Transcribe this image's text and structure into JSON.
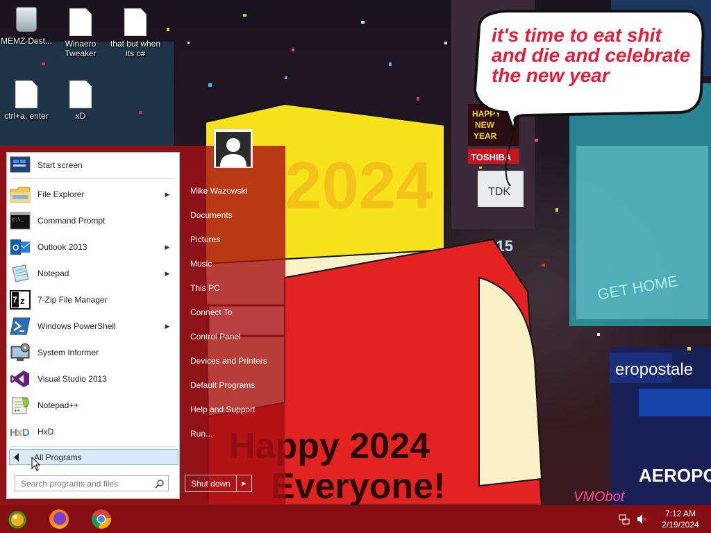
{
  "desktop": {
    "icons": [
      {
        "label": "MEMZ-Dest...",
        "icon": "recycle-bin-icon"
      },
      {
        "label": "Winaero Tweaker",
        "icon": "document-icon"
      },
      {
        "label": "that but when its c#",
        "icon": "document-icon"
      },
      {
        "label": "ctrl+a, enter",
        "icon": "document-icon"
      },
      {
        "label": "xD",
        "icon": "document-icon"
      }
    ]
  },
  "wallpaper": {
    "bubble": [
      "it's time to eat shit",
      "and die and celebrate",
      "the new year"
    ],
    "banner_year": "2024",
    "greeting": [
      "Happy 2024",
      "Everyone!"
    ],
    "sign_text": [
      "HAPPY",
      "NEW",
      "YEAR"
    ],
    "sign2": "TDK",
    "sign3": "2015",
    "sign4": "TOSHIBA",
    "sign5": "GET HOME",
    "sign6": "eropostale",
    "sign7": "AEROPOS",
    "signature": "VMObot",
    "colors": {
      "red": "#e32222",
      "yellow": "#f7e21b",
      "cream": "#fbf1c8",
      "bubble_text": "#e0203a"
    }
  },
  "start_menu": {
    "programs": [
      {
        "label": "Start screen",
        "icon": "start-screen-icon",
        "submenu": false
      },
      {
        "label": "File Explorer",
        "icon": "folder-icon",
        "submenu": true
      },
      {
        "label": "Command Prompt",
        "icon": "command-prompt-icon",
        "submenu": false
      },
      {
        "label": "Outlook 2013",
        "icon": "outlook-icon",
        "submenu": true
      },
      {
        "label": "Notepad",
        "icon": "notepad-icon",
        "submenu": true
      },
      {
        "label": "7-Zip File Manager",
        "icon": "7zip-icon",
        "submenu": false
      },
      {
        "label": "Windows PowerShell",
        "icon": "powershell-icon",
        "submenu": true
      },
      {
        "label": "System Informer",
        "icon": "system-informer-icon",
        "submenu": false
      },
      {
        "label": "Visual Studio 2013",
        "icon": "visual-studio-icon",
        "submenu": false
      },
      {
        "label": "Notepad++",
        "icon": "notepad-plus-plus-icon",
        "submenu": false
      },
      {
        "label": "HxD",
        "icon": "hxd-icon",
        "submenu": false
      }
    ],
    "all_programs": "All Programs",
    "search_placeholder": "Search programs and files",
    "user_name": "Mike Wazowski",
    "places": [
      "Documents",
      "Pictures",
      "Music",
      "This PC",
      "Connect To",
      "Control Panel",
      "Devices and Printers",
      "Default Programs",
      "Help and Support",
      "Run..."
    ],
    "shutdown_label": "Shut down",
    "shutdown_arrow": "▶",
    "submenu_arrow": "▶"
  },
  "taskbar": {
    "pinned": [
      "start-orb-icon",
      "firefox-icon",
      "chrome-icon"
    ],
    "tray": {
      "time": "7:12 AM",
      "date": "2/19/2024",
      "icons": [
        "network-icon",
        "volume-muted-icon"
      ]
    },
    "color": "#960f12"
  }
}
